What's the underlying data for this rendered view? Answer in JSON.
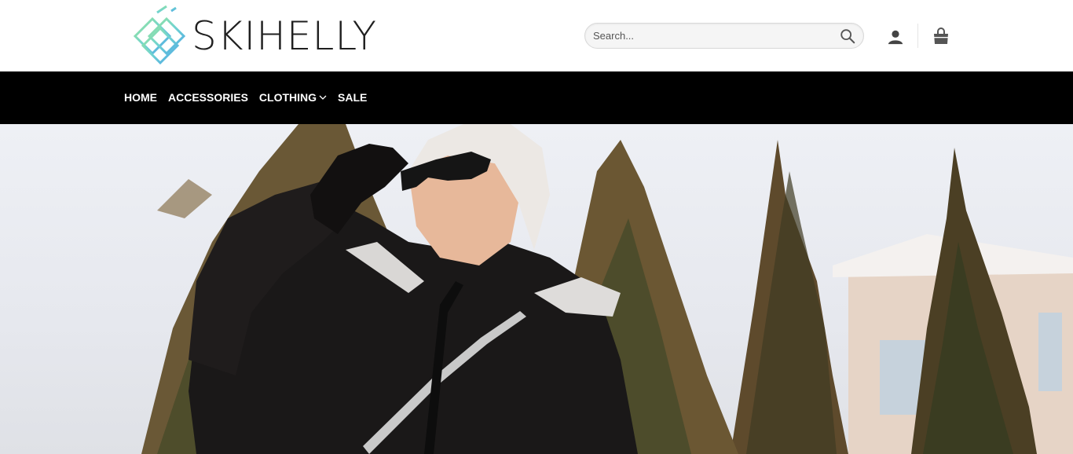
{
  "brand": {
    "name": "SKIHELLY"
  },
  "search": {
    "placeholder": "Search..."
  },
  "icons": {
    "search": "search-icon",
    "account": "user-icon",
    "cart": "shopping-bag-icon",
    "dropdown": "chevron-down-icon"
  },
  "nav": {
    "items": [
      {
        "label": "HOME"
      },
      {
        "label": "ACCESSORIES"
      },
      {
        "label": "CLOTHING",
        "has_dropdown": true
      },
      {
        "label": "SALE"
      }
    ]
  },
  "colors": {
    "nav_background": "#000000",
    "nav_text": "#ffffff",
    "logo_gradient_start": "#7de0c6",
    "logo_gradient_end": "#4aa3e8"
  }
}
